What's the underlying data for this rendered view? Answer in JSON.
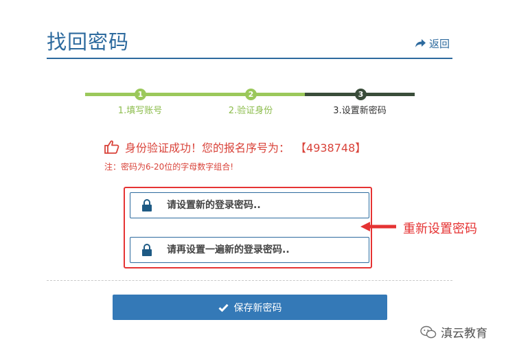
{
  "header": {
    "title": "找回密码",
    "back_label": "返回"
  },
  "steps": [
    {
      "number": "1",
      "label": "1.填写账号",
      "state": "done"
    },
    {
      "number": "2",
      "label": "2.验证身份",
      "state": "done"
    },
    {
      "number": "3",
      "label": "3.设置新密码",
      "state": "active"
    }
  ],
  "success": {
    "message": "身份验证成功！您的报名序号为：",
    "serial": "【4938748】"
  },
  "note": "注：密码为6-20位的字母数字组合!",
  "form": {
    "password_placeholder": "请设置新的登录密码..",
    "confirm_placeholder": "请再设置一遍新的登录密码.."
  },
  "annotation": "重新设置密码",
  "save_button_label": "保存新密码",
  "watermark": "滇云教育",
  "colors": {
    "primary": "#2d6a9e",
    "step_done": "#9bc85b",
    "step_active": "#3a4d3a",
    "error_red": "#d9433a",
    "highlight_red": "#e53333",
    "button": "#3479b7"
  }
}
